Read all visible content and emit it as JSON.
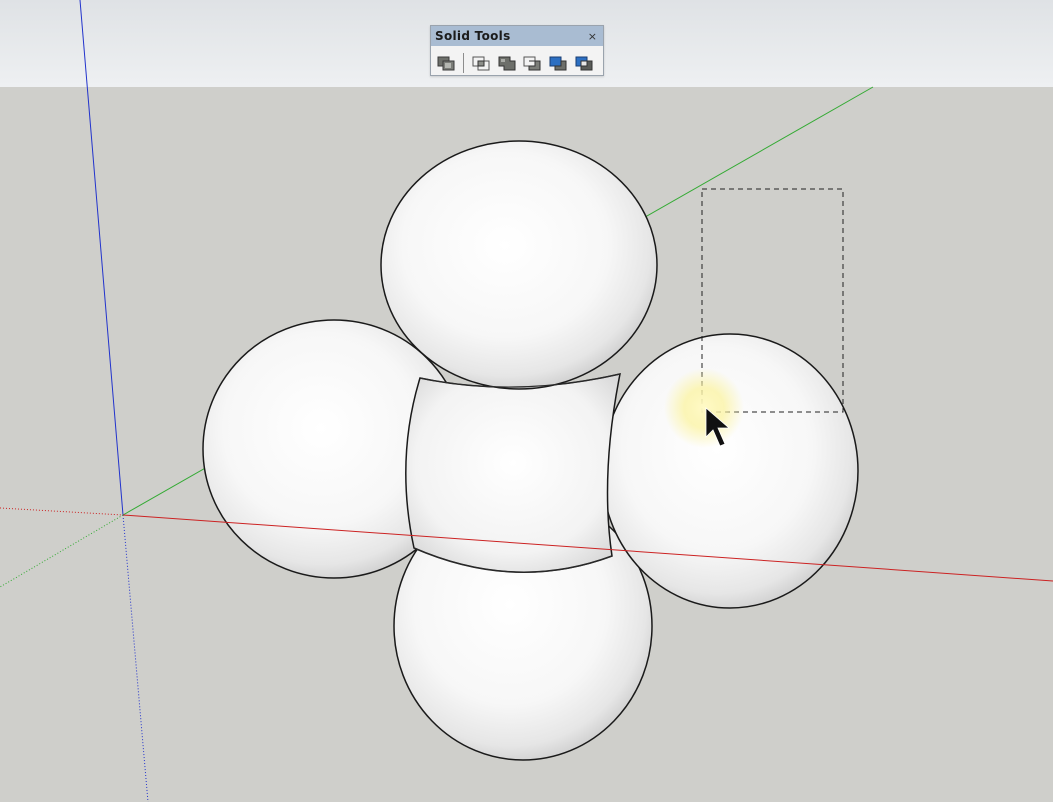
{
  "toolbar": {
    "title": "Solid Tools",
    "close_glyph": "×",
    "buttons": [
      {
        "icon": "outer-shell-icon"
      },
      {
        "icon": "intersect-icon"
      },
      {
        "icon": "union-icon"
      },
      {
        "icon": "subtract-icon"
      },
      {
        "icon": "trim-icon"
      },
      {
        "icon": "split-icon"
      }
    ]
  },
  "viewport": {
    "sky_color": "#e6e8ea",
    "ground_color": "#cfcfcb",
    "axis_colors": {
      "x": "#cc2222",
      "y": "#33aa33",
      "z": "#2233cc"
    },
    "cursor": "arrow-select-cursor",
    "selection_box": "dashed-marquee"
  }
}
